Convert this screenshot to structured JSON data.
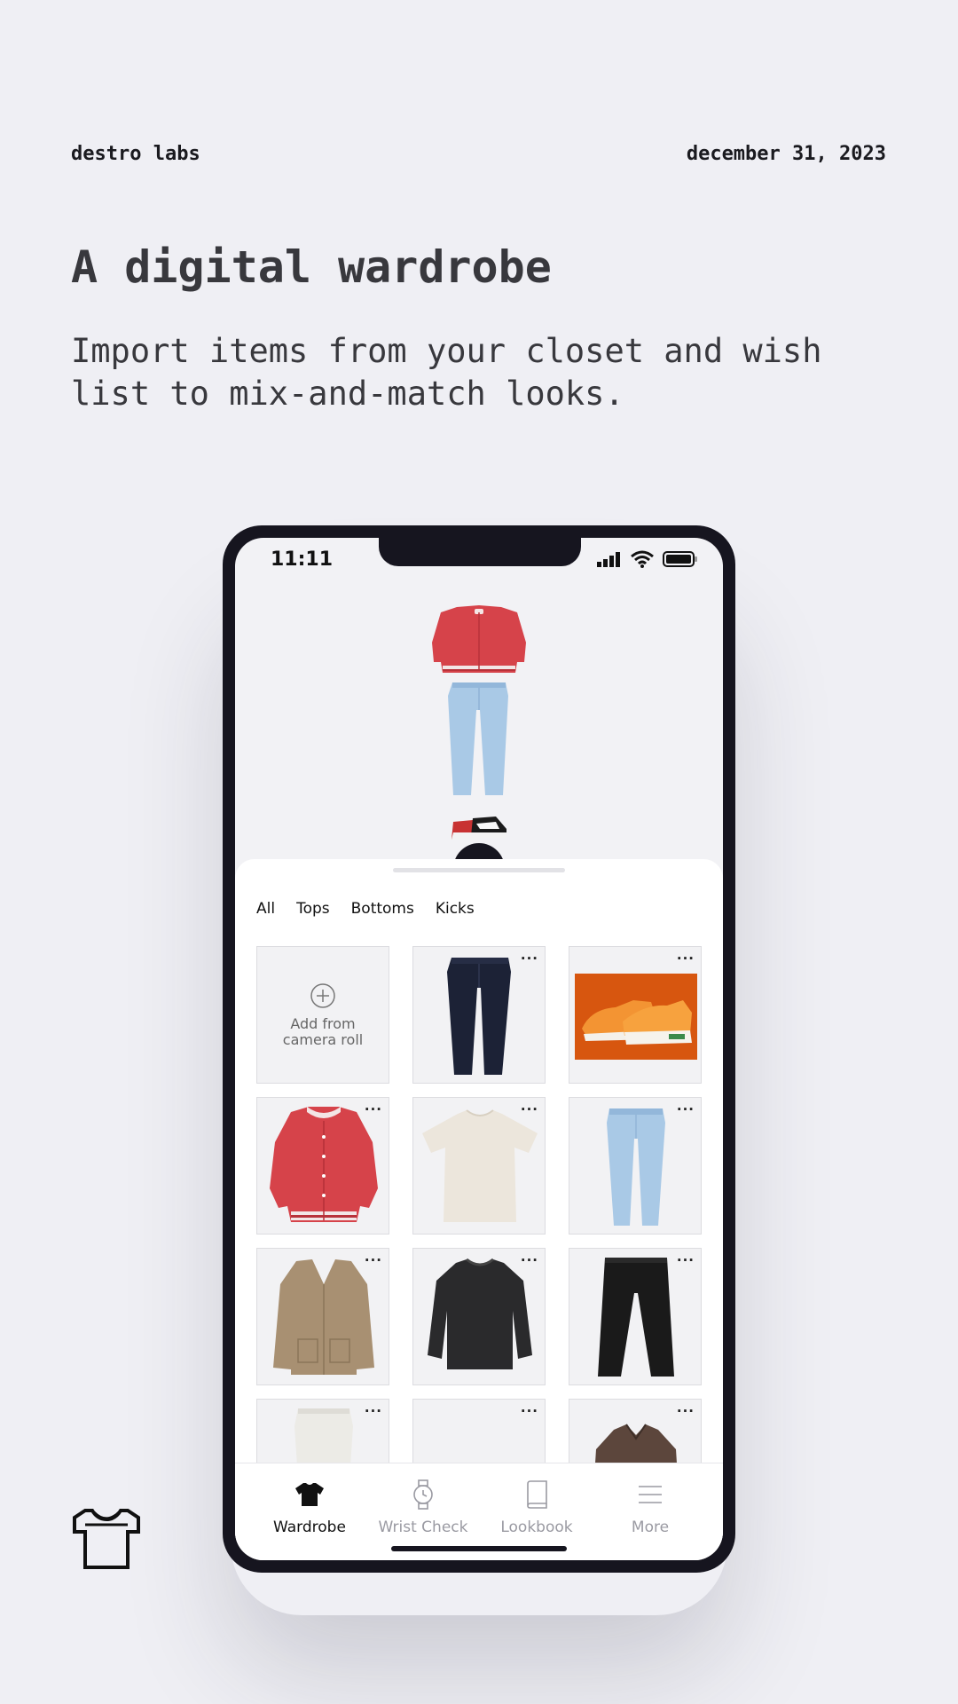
{
  "header": {
    "brand": "destro labs",
    "date": "december 31, 2023"
  },
  "hero": {
    "headline": "A digital wardrobe",
    "subhead": "Import items from your closet and wish list to mix-and-match looks."
  },
  "phone": {
    "status": {
      "time": "11:11"
    },
    "filters": [
      "All",
      "Tops",
      "Bottoms",
      "Kicks"
    ],
    "grid": {
      "add_label_line1": "Add from",
      "add_label_line2": "camera roll",
      "more_label": "···",
      "items": [
        {
          "name": "dark-jeans",
          "icon": "dark-jeans-image"
        },
        {
          "name": "orange-sneakers",
          "icon": "orange-sneakers-image"
        },
        {
          "name": "red-varsity-jacket",
          "icon": "red-jacket-image"
        },
        {
          "name": "cream-tshirt",
          "icon": "cream-tshirt-image"
        },
        {
          "name": "light-jeans",
          "icon": "light-jeans-image"
        },
        {
          "name": "tan-cardigan",
          "icon": "tan-cardigan-image"
        },
        {
          "name": "black-sweater",
          "icon": "black-sweater-image"
        },
        {
          "name": "black-trousers",
          "icon": "black-trousers-image"
        },
        {
          "name": "white-jeans",
          "icon": "white-jeans-image"
        },
        {
          "name": "empty-item",
          "icon": "blank-image"
        },
        {
          "name": "brown-jacket",
          "icon": "brown-jacket-image"
        }
      ]
    },
    "tabs": [
      {
        "label": "Wardrobe",
        "icon": "tshirt-icon",
        "active": true
      },
      {
        "label": "Wrist Check",
        "icon": "watch-icon",
        "active": false
      },
      {
        "label": "Lookbook",
        "icon": "book-icon",
        "active": false
      },
      {
        "label": "More",
        "icon": "menu-icon",
        "active": false
      }
    ]
  },
  "colors": {
    "background": "#efeff4",
    "phone_frame": "#16151f",
    "accent_red": "#d6434a"
  }
}
